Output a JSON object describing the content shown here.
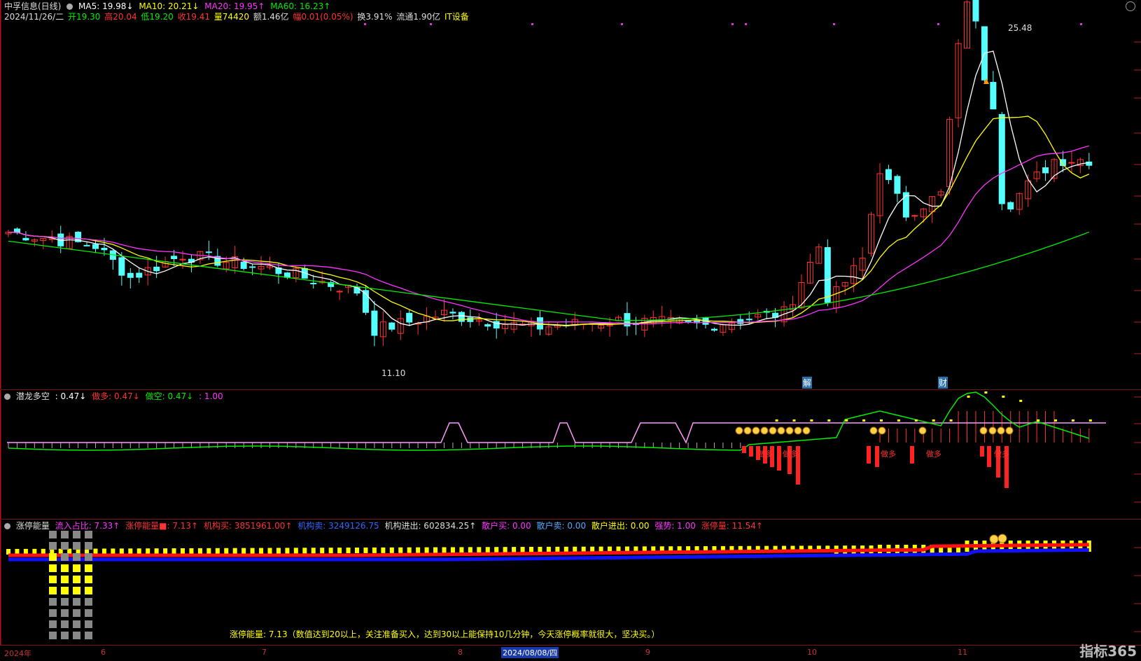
{
  "header": {
    "title": "中孚信息(日线)",
    "ma5": "MA5: 19.98↓",
    "ma10": "MA10: 20.21↓",
    "ma20": "MA20: 19.95↑",
    "ma60": "MA60: 16.23↑",
    "date": "2024/11/26/二",
    "open": "开19.30",
    "high": "高20.04",
    "low": "低19.20",
    "close": "收19.41",
    "volume": "量74420",
    "amount": "额1.46亿",
    "range": "幅0.01(0.05%)",
    "turnover": "换3.91%",
    "float": "流通1.90亿",
    "sector": "IT设备"
  },
  "main_chart": {
    "high_label": "25.48",
    "low_label": "11.10",
    "marker_jie": "解",
    "marker_cai": "财"
  },
  "ind1": {
    "name": "潜龙多空",
    "v1": ": 0.47↓",
    "v2": "做多: 0.47↓",
    "v3": "做空: 0.47↓",
    "v4": ": 1.00",
    "tag": "做多"
  },
  "ind2": {
    "name": "涨停能量",
    "v1": "流入占比: 7.33↑",
    "v2": "涨停能量■: 7.13↑",
    "v3": "机构买: 3851961.00↑",
    "v4": "机构卖: 3249126.75",
    "v5": "机构进出: 602834.25↑",
    "v6": "散户买: 0.00",
    "v7": "散户卖: 0.00",
    "v8": "散户进出: 0.00",
    "v9": "强势: 1.00",
    "v10": "涨停量: 11.54↑",
    "note": "涨停能量: 7.13（数值达到20以上，关注准备买入，达到30以上能保持10几分钟，今天涨停概率就很大，坚决买。）"
  },
  "axis": {
    "labels": [
      "2024年",
      "6",
      "7",
      "8",
      "9",
      "10",
      "11"
    ],
    "selected": "2024/08/08/四"
  },
  "logo": "指标365",
  "colors": {
    "up": "#ff3333",
    "down": "#54ffff",
    "ma5": "#ffffff",
    "ma10": "#ffff00",
    "ma20": "#ff33ff",
    "ma60": "#00ee00"
  }
}
